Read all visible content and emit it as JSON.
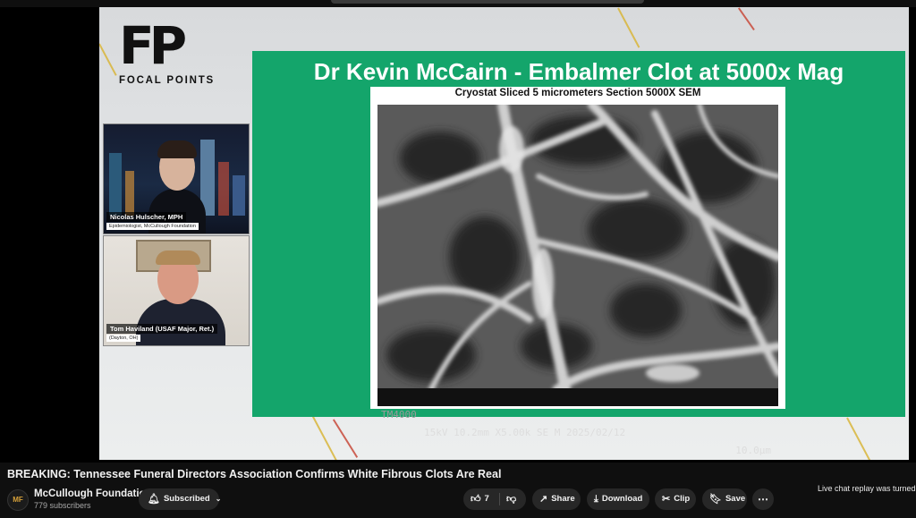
{
  "overlay": {
    "logo_mark": "FP",
    "logo_name": "FOCAL POINTS",
    "speaker1": {
      "name": "Nicolas Hulscher, MPH",
      "subtitle": "Epidemiologist, McCullough Foundation"
    },
    "speaker2": {
      "name": "Tom Haviland (USAF Major, Ret.)",
      "subtitle": "(Dayton, OH)"
    }
  },
  "slide": {
    "title": "Dr Kevin McCairn - Embalmer Clot at 5000x Mag",
    "image_caption": "Cryostat Sliced 5 micrometers Section 5000X SEM",
    "sem_label": "TM4000",
    "sem_info": "15kV 10.2mm X5.00k SE M 2025/02/12",
    "sem_scale": "10.0μm",
    "colors": {
      "background": "#14a56b"
    }
  },
  "video": {
    "title": "BREAKING: Tennessee Funeral Directors Association Confirms White Fibrous Clots Are Real"
  },
  "channel": {
    "avatar_initials": "MF",
    "name": "McCullough Foundation",
    "subscribers": "779 subscribers",
    "subscribe_label": "Subscribed"
  },
  "actions": {
    "like_count": "7",
    "share_label": "Share",
    "download_label": "Download",
    "clip_label": "Clip",
    "save_label": "Save"
  },
  "chat": {
    "notice": "Live chat replay was turned o"
  }
}
